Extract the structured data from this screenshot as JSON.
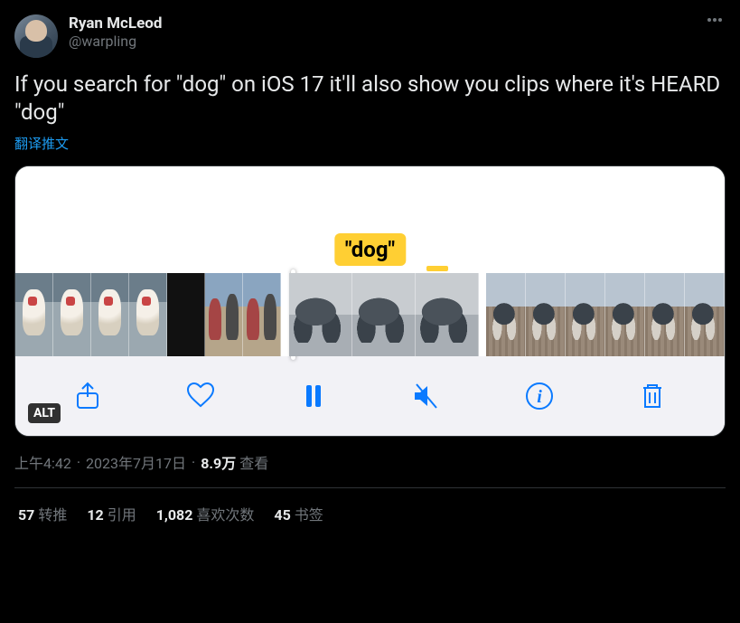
{
  "author": {
    "display_name": "Ryan McLeod",
    "handle": "@warpling"
  },
  "tweet_text": "If you search for \"dog\" on iOS 17 it'll also show you clips where it's HEARD \"dog\"",
  "translate_label": "翻译推文",
  "media": {
    "search_label": "\"dog\"",
    "alt_badge": "ALT"
  },
  "meta": {
    "time": "上午4:42",
    "date": "2023年7月17日",
    "views_count": "8.9万",
    "views_label": "查看"
  },
  "stats": {
    "retweet_count": "57",
    "retweet_label": "转推",
    "quote_count": "12",
    "quote_label": "引用",
    "like_count": "1,082",
    "like_label": "喜欢次数",
    "bookmark_count": "45",
    "bookmark_label": "书签"
  }
}
